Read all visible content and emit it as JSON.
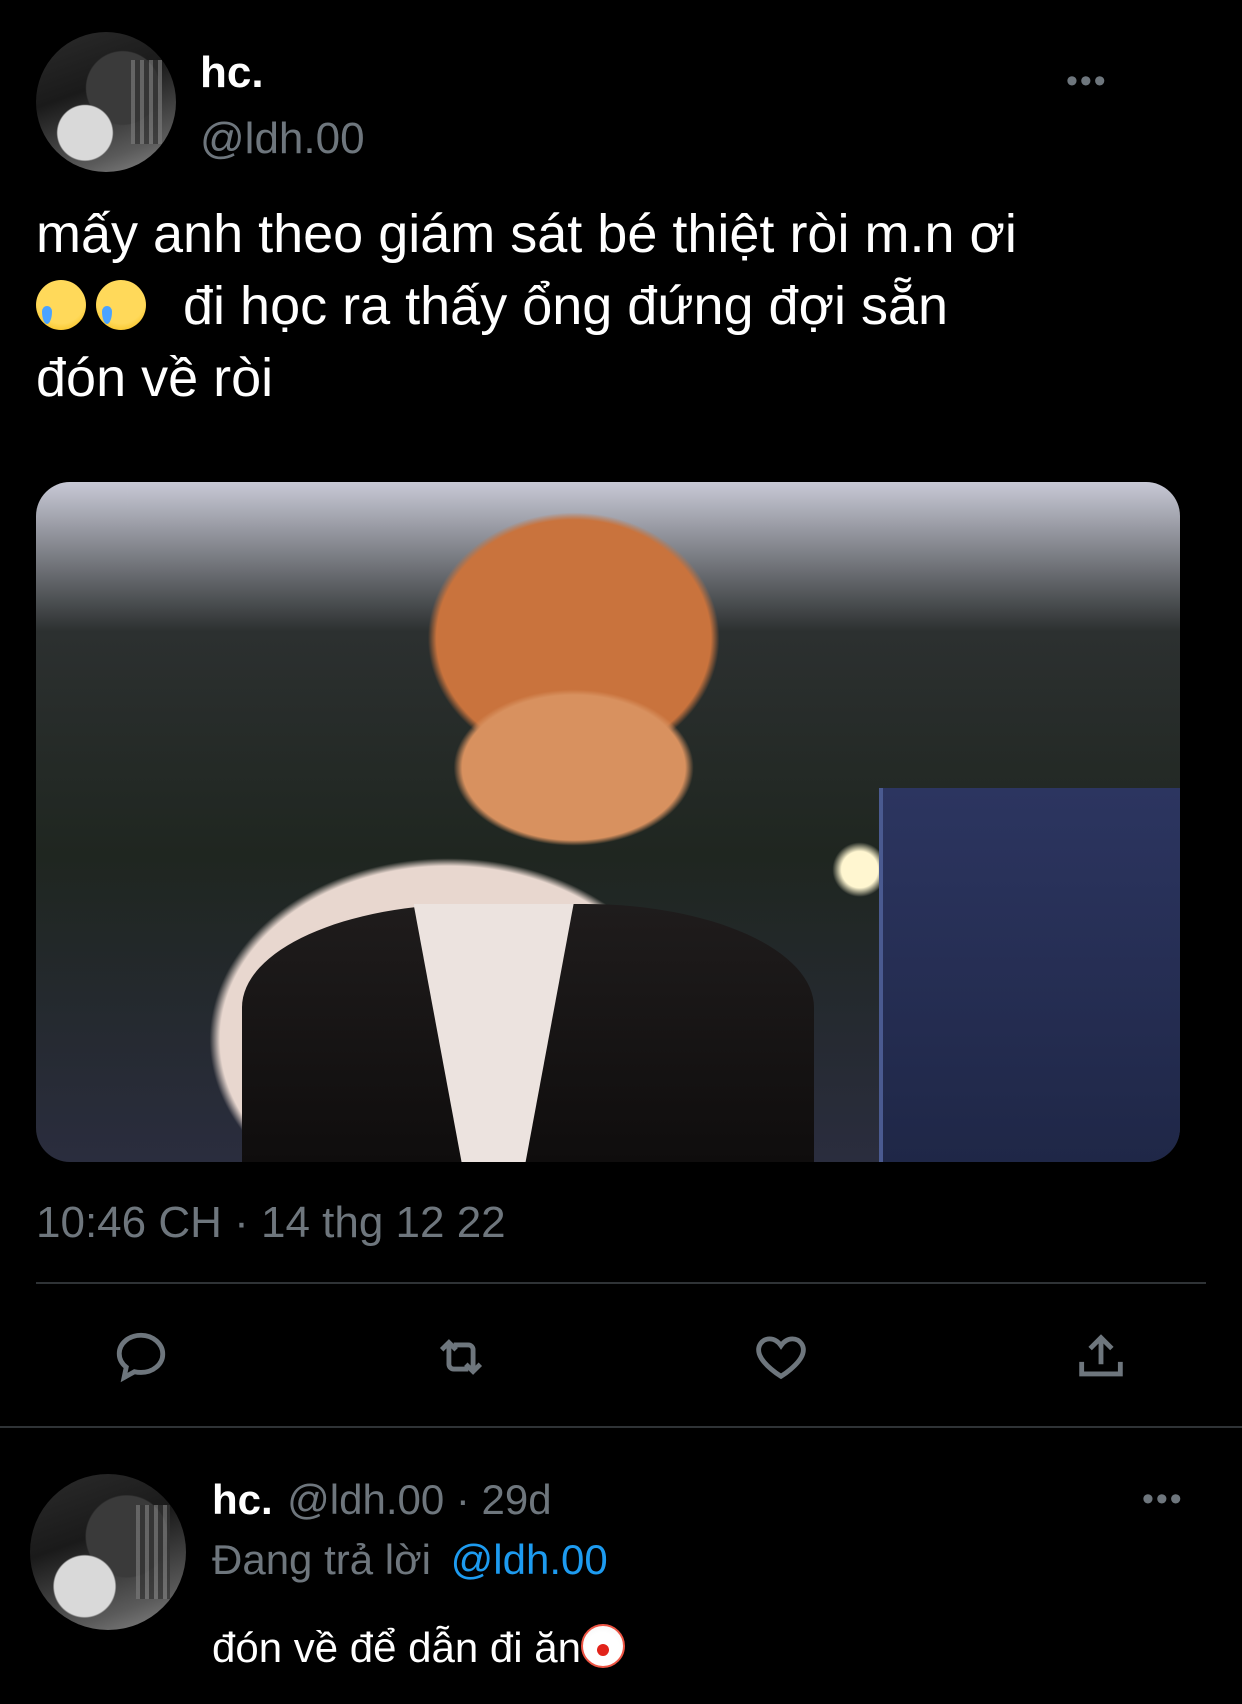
{
  "tweet": {
    "author_name": "hc.",
    "author_handle": "@ldh.00",
    "text_line1": "mấy anh theo giám sát bé thiệt ròi m.n ơi",
    "text_line2": "đi học ra thấy ổng đứng đợi sẵn",
    "text_line3": "đón về ròi",
    "emojis_line2": [
      "sad-but-relieved-face-emoji",
      "sad-but-relieved-face-emoji"
    ],
    "timestamp": "10:46 CH · 14 thg 12 22",
    "more_label": "•••"
  },
  "actions": [
    {
      "name": "reply-icon"
    },
    {
      "name": "retweet-icon"
    },
    {
      "name": "like-icon"
    },
    {
      "name": "share-icon"
    }
  ],
  "reply": {
    "author_name": "hc.",
    "author_handle": "@ldh.00 · 29d",
    "replying_prefix": "Đang trả lời",
    "replying_to": "@ldh.00",
    "text": "đón về để dẫn đi ăn",
    "emoji": "clown-face-emoji",
    "more_label": "•••"
  },
  "colors": {
    "background": "#000000",
    "text": "#ffffff",
    "secondary": "#6e767d",
    "link": "#1d9bf0",
    "divider": "#2f3336"
  }
}
